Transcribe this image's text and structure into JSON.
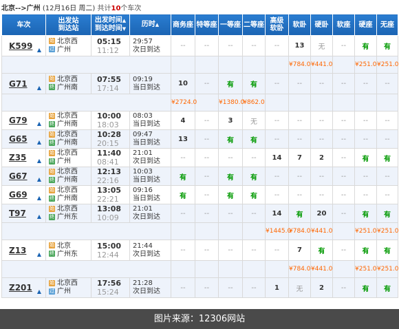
{
  "header": {
    "route": "北京-->广州",
    "date": "(12月16日 周二)",
    "count_prefix": "共计",
    "count": "10",
    "count_suffix": "个车次"
  },
  "columns": {
    "train": "车次",
    "stations_top": "出发站",
    "stations_bottom": "到达站",
    "times_top": "出发时间",
    "times_bottom": "到达时间",
    "duration": "历时",
    "swz": "商务座",
    "tdz": "特等座",
    "ydz": "一等座",
    "edz": "二等座",
    "gjrw_top": "高级",
    "gjrw_bottom": "软卧",
    "rw": "软卧",
    "yw": "硬卧",
    "rz": "软座",
    "yz": "硬座",
    "wz": "无座"
  },
  "rows": [
    {
      "train": "K599",
      "from": "北京西",
      "from_type": "始",
      "to": "广州",
      "to_type": "过",
      "depart": "05:15",
      "arrive": "11:12",
      "duration": "29:57",
      "next_day": "次日到达",
      "seats": [
        "--",
        "--",
        "--",
        "--",
        "--",
        "13",
        "无",
        "--",
        "有",
        "有"
      ],
      "prices": [
        "",
        "",
        "",
        "",
        "",
        "¥784.0",
        "¥441.0",
        "",
        "¥251.0",
        "¥251.0"
      ]
    },
    {
      "train": "G71",
      "from": "北京西",
      "from_type": "始",
      "to": "广州南",
      "to_type": "终",
      "depart": "07:55",
      "arrive": "17:14",
      "duration": "09:19",
      "next_day": "当日到达",
      "seats": [
        "10",
        "--",
        "有",
        "有",
        "--",
        "--",
        "--",
        "--",
        "--",
        "--"
      ],
      "prices": [
        "¥2724.0",
        "",
        "¥1380.0",
        "¥862.0",
        "",
        "",
        "",
        "",
        "",
        ""
      ]
    },
    {
      "train": "G79",
      "from": "北京西",
      "from_type": "始",
      "to": "广州南",
      "to_type": "终",
      "depart": "10:00",
      "arrive": "18:03",
      "duration": "08:03",
      "next_day": "当日到达",
      "seats": [
        "4",
        "--",
        "3",
        "无",
        "--",
        "--",
        "--",
        "--",
        "--",
        "--"
      ]
    },
    {
      "train": "G65",
      "from": "北京西",
      "from_type": "始",
      "to": "广州南",
      "to_type": "终",
      "depart": "10:28",
      "arrive": "20:15",
      "duration": "09:47",
      "next_day": "当日到达",
      "seats": [
        "13",
        "--",
        "有",
        "有",
        "--",
        "--",
        "--",
        "--",
        "--",
        "--"
      ]
    },
    {
      "train": "Z35",
      "from": "北京西",
      "from_type": "始",
      "to": "广州",
      "to_type": "终",
      "depart": "11:40",
      "arrive": "08:41",
      "duration": "21:01",
      "next_day": "次日到达",
      "seats": [
        "--",
        "--",
        "--",
        "--",
        "14",
        "7",
        "2",
        "--",
        "有",
        "有"
      ]
    },
    {
      "train": "G67",
      "from": "北京西",
      "from_type": "始",
      "to": "广州南",
      "to_type": "终",
      "depart": "12:13",
      "arrive": "22:16",
      "duration": "10:03",
      "next_day": "当日到达",
      "seats": [
        "有",
        "--",
        "有",
        "有",
        "--",
        "--",
        "--",
        "--",
        "--",
        "--"
      ]
    },
    {
      "train": "G69",
      "from": "北京西",
      "from_type": "始",
      "to": "广州南",
      "to_type": "终",
      "depart": "13:05",
      "arrive": "22:21",
      "duration": "09:16",
      "next_day": "当日到达",
      "seats": [
        "有",
        "--",
        "有",
        "有",
        "--",
        "--",
        "--",
        "--",
        "--",
        "--"
      ]
    },
    {
      "train": "T97",
      "from": "北京西",
      "from_type": "始",
      "to": "广州东",
      "to_type": "终",
      "depart": "13:08",
      "arrive": "10:09",
      "duration": "21:01",
      "next_day": "次日到达",
      "seats": [
        "--",
        "--",
        "--",
        "--",
        "14",
        "有",
        "20",
        "--",
        "有",
        "有"
      ],
      "prices": [
        "",
        "",
        "",
        "",
        "¥1445.0",
        "¥784.0",
        "¥441.0",
        "",
        "¥251.0",
        "¥251.0"
      ]
    },
    {
      "train": "Z13",
      "from": "北京",
      "from_type": "始",
      "to": "广州东",
      "to_type": "终",
      "depart": "15:00",
      "arrive": "12:44",
      "duration": "21:44",
      "next_day": "次日到达",
      "seats": [
        "--",
        "--",
        "--",
        "--",
        "--",
        "7",
        "有",
        "--",
        "有",
        "有"
      ],
      "prices": [
        "",
        "",
        "",
        "",
        "",
        "¥784.0",
        "¥441.0",
        "",
        "¥251.0",
        "¥251.0"
      ]
    },
    {
      "train": "Z201",
      "from": "北京西",
      "from_type": "始",
      "to": "广州",
      "to_type": "过",
      "depart": "17:56",
      "arrive": "15:24",
      "duration": "21:28",
      "next_day": "次日到达",
      "seats": [
        "--",
        "--",
        "--",
        "--",
        "1",
        "无",
        "2",
        "--",
        "有",
        "有"
      ]
    }
  ],
  "footer": {
    "text": "图片来源：12306网站"
  },
  "colors": {
    "header_blue": "#1b64b3",
    "available_green": "#009900",
    "price_orange": "#ff6600",
    "footer_bg": "#4a4a4a"
  }
}
